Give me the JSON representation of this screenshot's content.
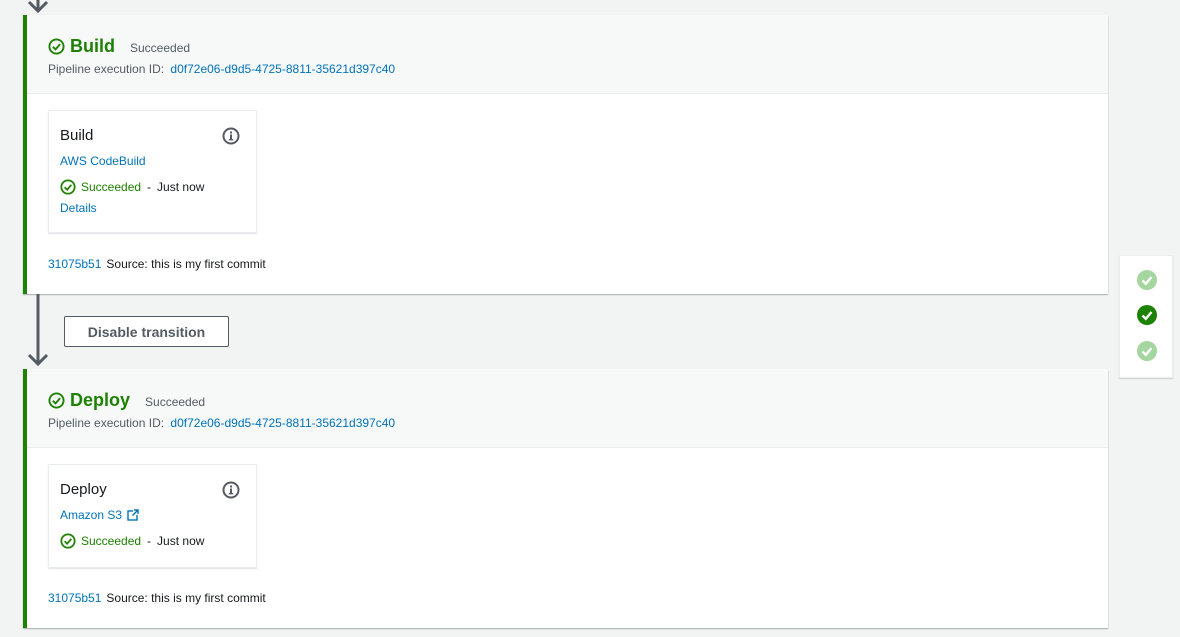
{
  "stages": {
    "build": {
      "title": "Build",
      "status": "Succeeded",
      "exec_label": "Pipeline execution ID:",
      "exec_id": "d0f72e06-d9d5-4725-8811-35621d397c40",
      "action": {
        "name": "Build",
        "provider": "AWS CodeBuild",
        "status": "Succeeded",
        "separator": "-",
        "time": "Just now",
        "details": "Details"
      },
      "commit_id": "31075b51",
      "commit_msg": "Source: this is my first commit"
    },
    "deploy": {
      "title": "Deploy",
      "status": "Succeeded",
      "exec_label": "Pipeline execution ID:",
      "exec_id": "d0f72e06-d9d5-4725-8811-35621d397c40",
      "action": {
        "name": "Deploy",
        "provider": "Amazon S3",
        "status": "Succeeded",
        "separator": "-",
        "time": "Just now"
      },
      "commit_id": "31075b51",
      "commit_msg": "Source: this is my first commit"
    }
  },
  "transition": {
    "button_label": "Disable transition"
  },
  "icons": {
    "success": "check-circle-icon",
    "info": "info-icon",
    "external": "external-link-icon",
    "arrow": "arrow-down-icon"
  },
  "colors": {
    "success": "#1d8102",
    "link": "#0073bb",
    "muted_success": "#a5d6a0"
  }
}
